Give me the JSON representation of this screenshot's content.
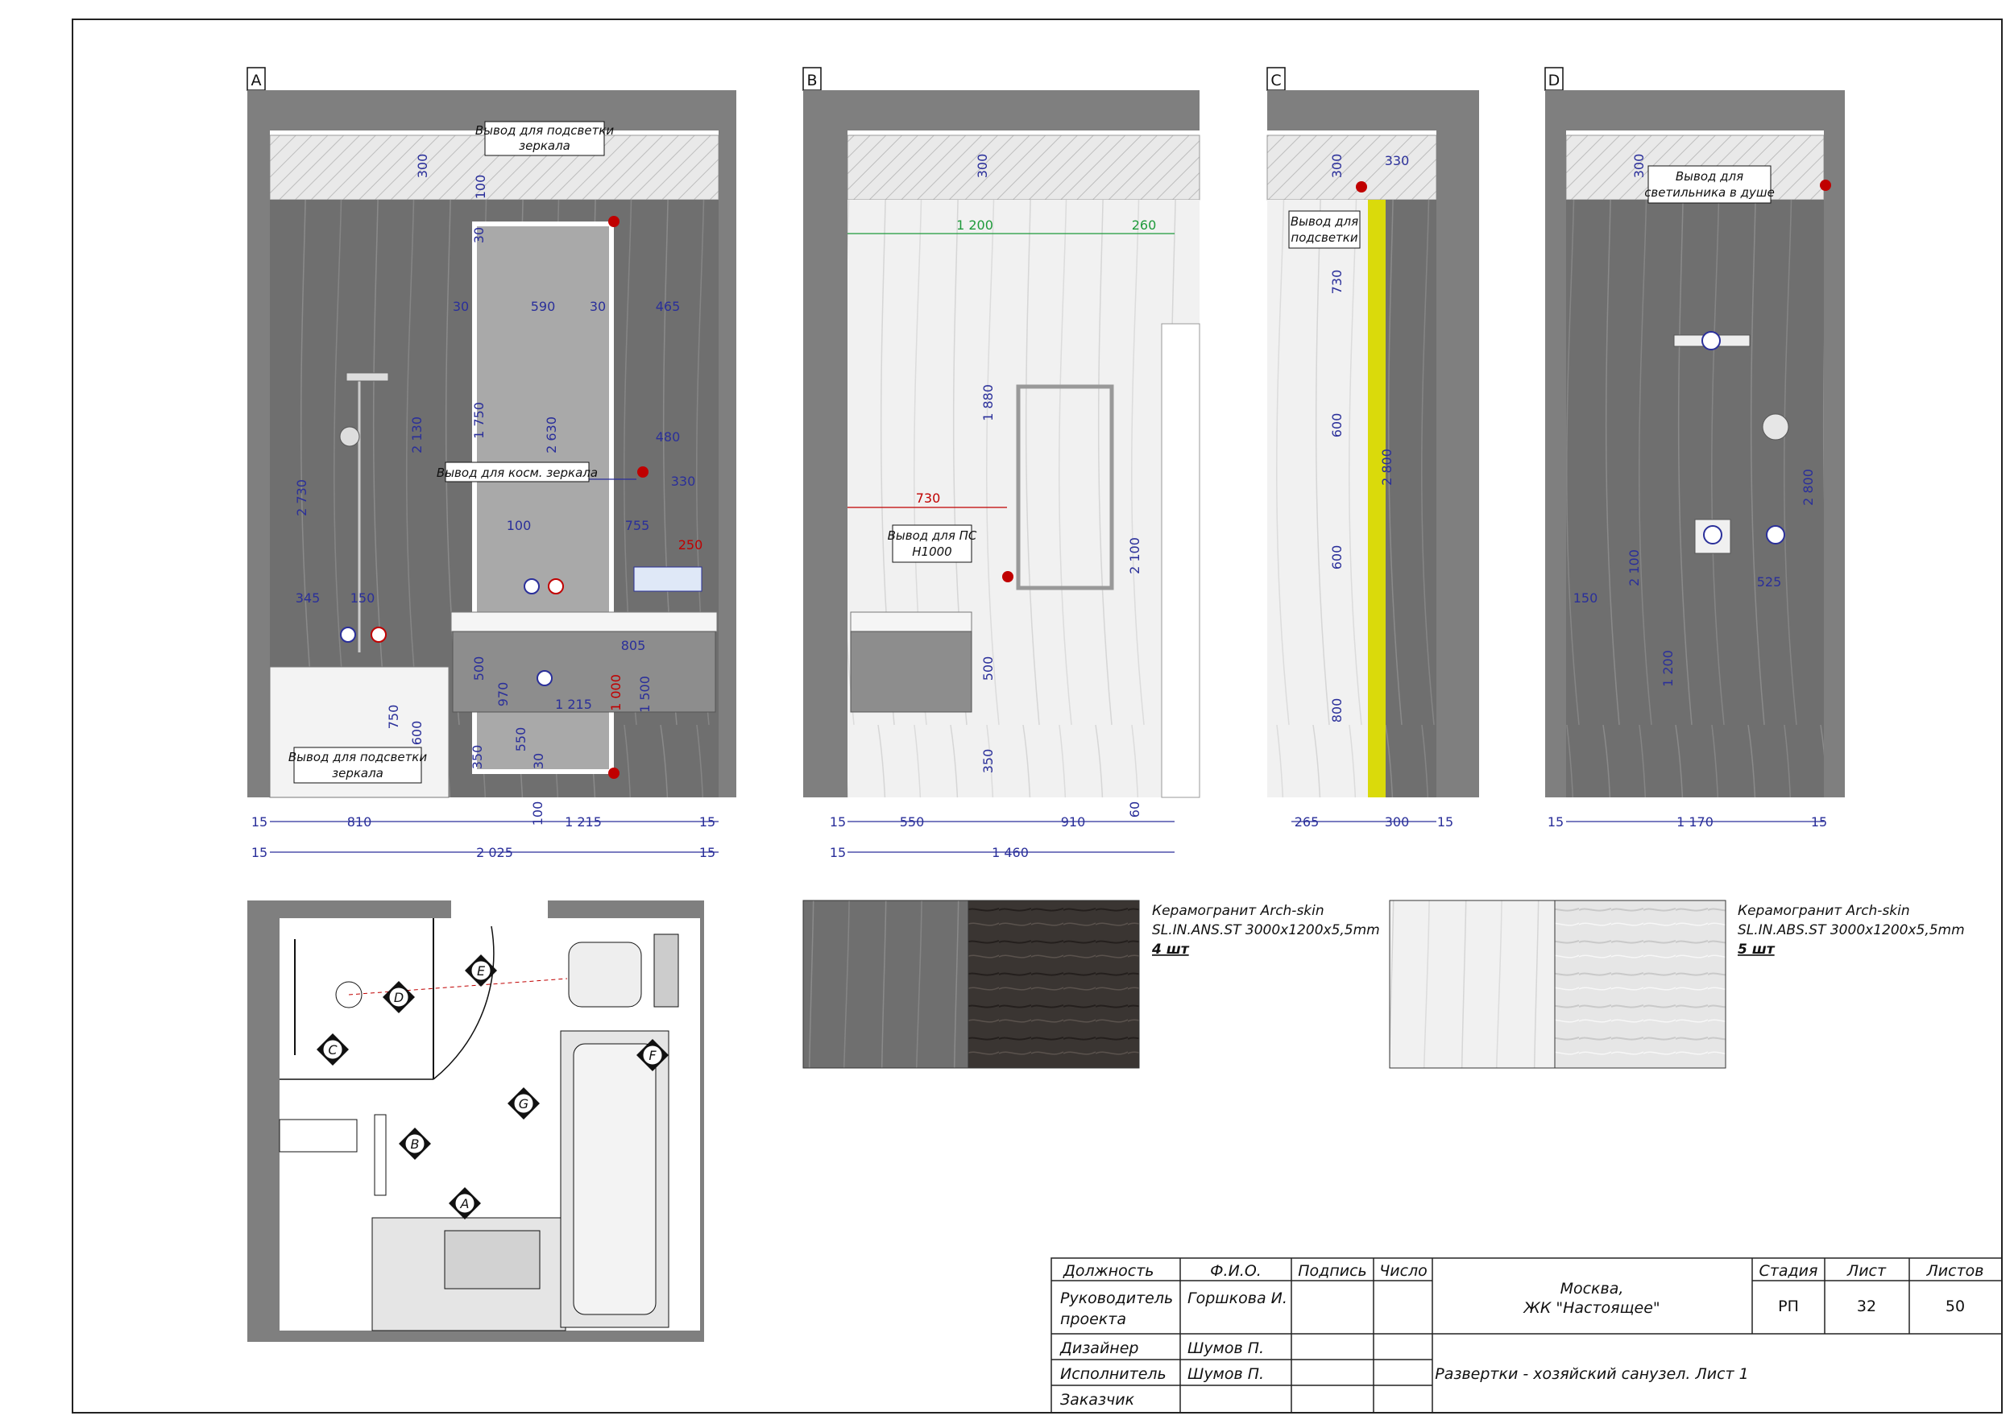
{
  "views": {
    "a": {
      "letter": "A",
      "callouts": [
        "Вывод для подсветки",
        "зеркала",
        "Вывод для косм. зеркала",
        "Вывод для подсветки",
        "зеркала"
      ],
      "dims": [
        "300",
        "100",
        "30",
        "2 730",
        "2 130",
        "1 750",
        "2 630",
        "30",
        "590",
        "30",
        "465",
        "480",
        "330",
        "100",
        "755",
        "250",
        "345",
        "150",
        "805",
        "500",
        "970",
        "1 215",
        "1 500",
        "1 000",
        "750",
        "600",
        "550",
        "30",
        "350",
        "100",
        "15",
        "810",
        "1 215",
        "15",
        "15",
        "2 025",
        "15"
      ]
    },
    "b": {
      "letter": "B",
      "callouts": [
        "Вывод для ПС",
        "H1000"
      ],
      "dims": [
        "300",
        "1 200",
        "260",
        "1 880",
        "730",
        "2 100",
        "500",
        "350",
        "60",
        "15",
        "550",
        "910",
        "15",
        "1 460"
      ]
    },
    "c": {
      "letter": "C",
      "callouts": [
        "Вывод для",
        "подсветки"
      ],
      "dims": [
        "300",
        "330",
        "730",
        "600",
        "2 800",
        "600",
        "800",
        "265",
        "300",
        "15"
      ]
    },
    "d": {
      "letter": "D",
      "callouts": [
        "Вывод для",
        "светильника в душе"
      ],
      "dims": [
        "300",
        "2 800",
        "2 100",
        "1 200",
        "150",
        "525",
        "15",
        "1 170",
        "15"
      ]
    }
  },
  "plan": {
    "markers": [
      "E",
      "D",
      "C",
      "F",
      "G",
      "B",
      "A"
    ]
  },
  "materials": [
    {
      "name": "Керамогранит Arch-skin",
      "spec": "SL.IN.ANS.ST 3000x1200x5,5mm",
      "qty": "4 шт",
      "swatch": "#3a3532"
    },
    {
      "name": "Керамогранит Arch-skin",
      "spec": "SL.IN.ABS.ST 3000x1200x5,5mm",
      "qty": "5 шт",
      "swatch": "#e6e6e6"
    }
  ],
  "title_block": {
    "headers": [
      "Должность",
      "Ф.И.О.",
      "Подпись",
      "Число"
    ],
    "rows": [
      {
        "role": [
          "Руководитель",
          "проекта"
        ],
        "name": "Горшкова И."
      },
      {
        "role": [
          "Дизайнер"
        ],
        "name": "Шумов П."
      },
      {
        "role": [
          "Исполнитель"
        ],
        "name": "Шумов П."
      },
      {
        "role": [
          "Заказчик"
        ],
        "name": ""
      }
    ],
    "city": "Москва,",
    "complex": "ЖК \"Настоящее\"",
    "sheet_title": "Развертки - хозяйский санузел. Лист 1",
    "stage_label": "Стадия",
    "stage": "РП",
    "sheet_label": "Лист",
    "sheet": "32",
    "sheets_label": "Листов",
    "sheets": "50"
  },
  "colors": {
    "wall": "#7f7f7f",
    "tile_dark": "#6f6f6f",
    "tile_light": "#f1f1f1",
    "dim": "#2a2f9a",
    "accent_red": "#c00000",
    "led": "#e6e600"
  }
}
